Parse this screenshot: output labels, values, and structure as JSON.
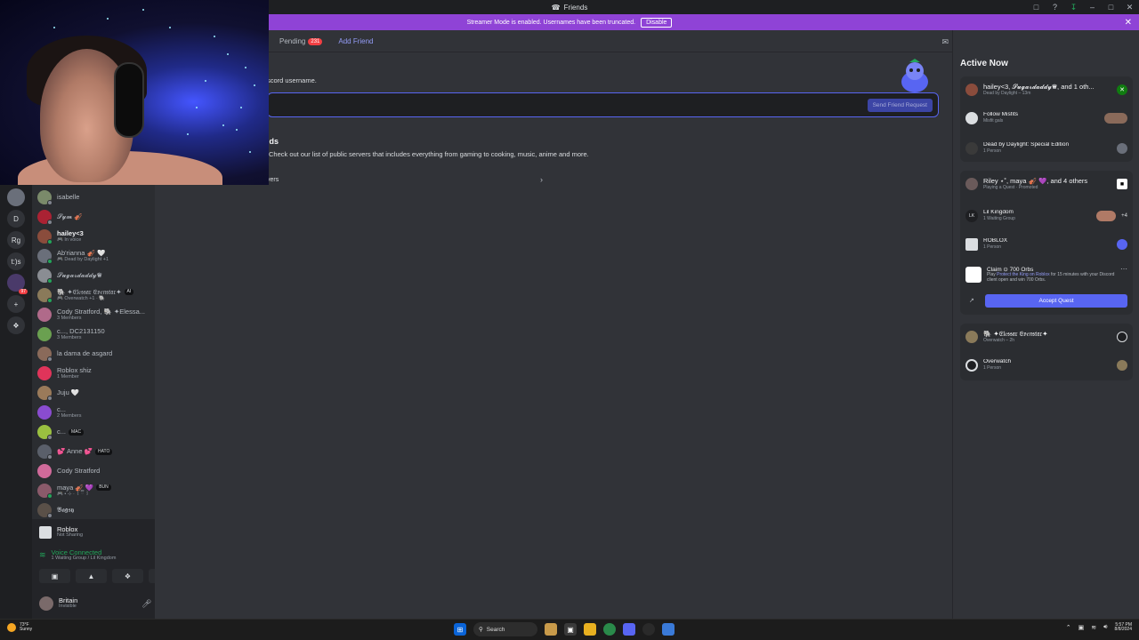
{
  "window": {
    "title": "Friends"
  },
  "banner": {
    "text": "Streamer Mode is enabled. Usernames have been truncated.",
    "button": "Disable"
  },
  "tabs": {
    "pending_label": "Pending",
    "pending_count": "231",
    "add_friend": "Add Friend"
  },
  "add_friend": {
    "description": "scord username.",
    "send_button": "Send Friend Request"
  },
  "more_servers": {
    "title": "ends",
    "description": "Check out our list of public servers that includes everything from gaming to cooking, music, anime and more.",
    "link": "vers"
  },
  "servers": {
    "items": [
      "D",
      "Rg",
      "t:)s"
    ],
    "badge": "97"
  },
  "dms": [
    {
      "name": "isabelle",
      "sub": "",
      "color": "#7a8a6a",
      "status": "off",
      "bold": false
    },
    {
      "name": "𝓢𝔂𝓶 🎻",
      "sub": "",
      "color": "#aa2233",
      "status": "off",
      "bold": false
    },
    {
      "name": "hailey<3",
      "sub": "🎮 In voice",
      "color": "#8a4c3c",
      "status": "on",
      "bold": true
    },
    {
      "name": "Ab'rianna 🎻 🤍",
      "sub": "🎮 Dead by Daylight +1",
      "color": "#6a6f7a",
      "status": "on",
      "bold": false
    },
    {
      "name": "𝓢𝓾𝓰𝓪𝓻𝓭𝓪𝓭𝓭𝔂♛",
      "sub": "",
      "color": "#8a8d93",
      "status": "on",
      "bold": false
    },
    {
      "name": "🐘 ✦𝔈𝔩𝔢𝔰𝔰𝔞𝔯 𝔈𝔳𝔢𝔫𝔰𝔱𝔞𝔯✦",
      "sub": "🎮 Overwatch +1 · 🐘",
      "color": "#8a7a5a",
      "status": "on",
      "bold": false
    },
    {
      "name": "Cody Stratford, 🐘 ✦Elessa...",
      "sub": "3 Members",
      "color": "#b06a8a",
      "status": "none",
      "bold": false
    },
    {
      "name": "c..., DC2131150",
      "sub": "3 Members",
      "color": "#6aa050",
      "status": "none",
      "bold": false
    },
    {
      "name": "la dama de asgard",
      "sub": "",
      "color": "#8a6a5a",
      "status": "off",
      "bold": false
    },
    {
      "name": "Roblox shiz",
      "sub": "1 Member",
      "color": "#e0345a",
      "status": "none",
      "bold": false
    },
    {
      "name": "Juju 🤍",
      "sub": "",
      "color": "#9a7a5a",
      "status": "off",
      "bold": false
    },
    {
      "name": "c...",
      "sub": "2 Members",
      "color": "#8a4cd0",
      "status": "none",
      "bold": false
    },
    {
      "name": "c...",
      "sub": "",
      "color": "#9ac040",
      "status": "off",
      "bold": false
    },
    {
      "name": "💕 Anne 💕",
      "sub": "",
      "color": "#5a5f6a",
      "status": "off",
      "bold": false
    },
    {
      "name": "Cody Stratford",
      "sub": "",
      "color": "#d06a9a",
      "status": "none",
      "bold": false
    },
    {
      "name": "maya 🎻 💜",
      "sub": "🎮 • ⊹ · ꒰ ྀི ꒱",
      "color": "#8a5a6a",
      "status": "on",
      "bold": false
    },
    {
      "name": "𝕭𝖆𝖌𝖘𝖞",
      "sub": "",
      "color": "#5a5048",
      "status": "off",
      "bold": false
    }
  ],
  "dm_tags": {
    "elessar": "AI",
    "c": "MAC",
    "anne": "HATO",
    "maya": "BUN"
  },
  "panel": {
    "activity_title": "Roblox",
    "activity_sub": "Not Sharing",
    "voice_title": "Voice Connected",
    "voice_sub": "1 Waiting Group / Lil Kingdom",
    "user_name": "Britain",
    "user_status": "Invisible"
  },
  "active_now": {
    "title": "Active Now",
    "card1": {
      "head": "hailey<3, 𝓢𝓾𝓰𝓪𝓻𝓭𝓪𝓭𝓭𝔂♛, and 1 oth...",
      "head_sub": "Dead by Daylight – 13m",
      "r1_name": "Follow Misfits",
      "r1_sub": "Misfit gals",
      "r2_name": "Dead by Daylight: Special Edition",
      "r2_sub": "1 Person"
    },
    "card2": {
      "head": "Riley ⋆˚, maya 🎻 💜, and 4 others",
      "head_sub": "Playing a Quest · Promoted",
      "r1_name": "Lil Kingdom",
      "r1_sub": "1 Waiting Group",
      "r1_extra": "+4",
      "r2_name": "ROBLOX",
      "r2_sub": "1 Person",
      "quest_title": "Claim ⊙ 700 Orbs",
      "quest_desc_1": "Play ",
      "quest_link": "Protect the King on Roblox",
      "quest_desc_2": " for 15 minutes with your Discord client open and win 700 Orbs.",
      "quest_button": "Accept Quest"
    },
    "card3": {
      "head": "🐘 ✦𝔈𝔩𝔢𝔰𝔰𝔞𝔯 𝔈𝔳𝔢𝔫𝔰𝔱𝔞𝔯✦",
      "head_sub": "Overwatch – 2h",
      "r1_name": "Overwatch",
      "r1_sub": "1 Person"
    }
  },
  "taskbar": {
    "temp": "73°F",
    "weather": "Sunny",
    "search": "Search",
    "time": "5:57 PM",
    "date": "8/8/2024"
  }
}
